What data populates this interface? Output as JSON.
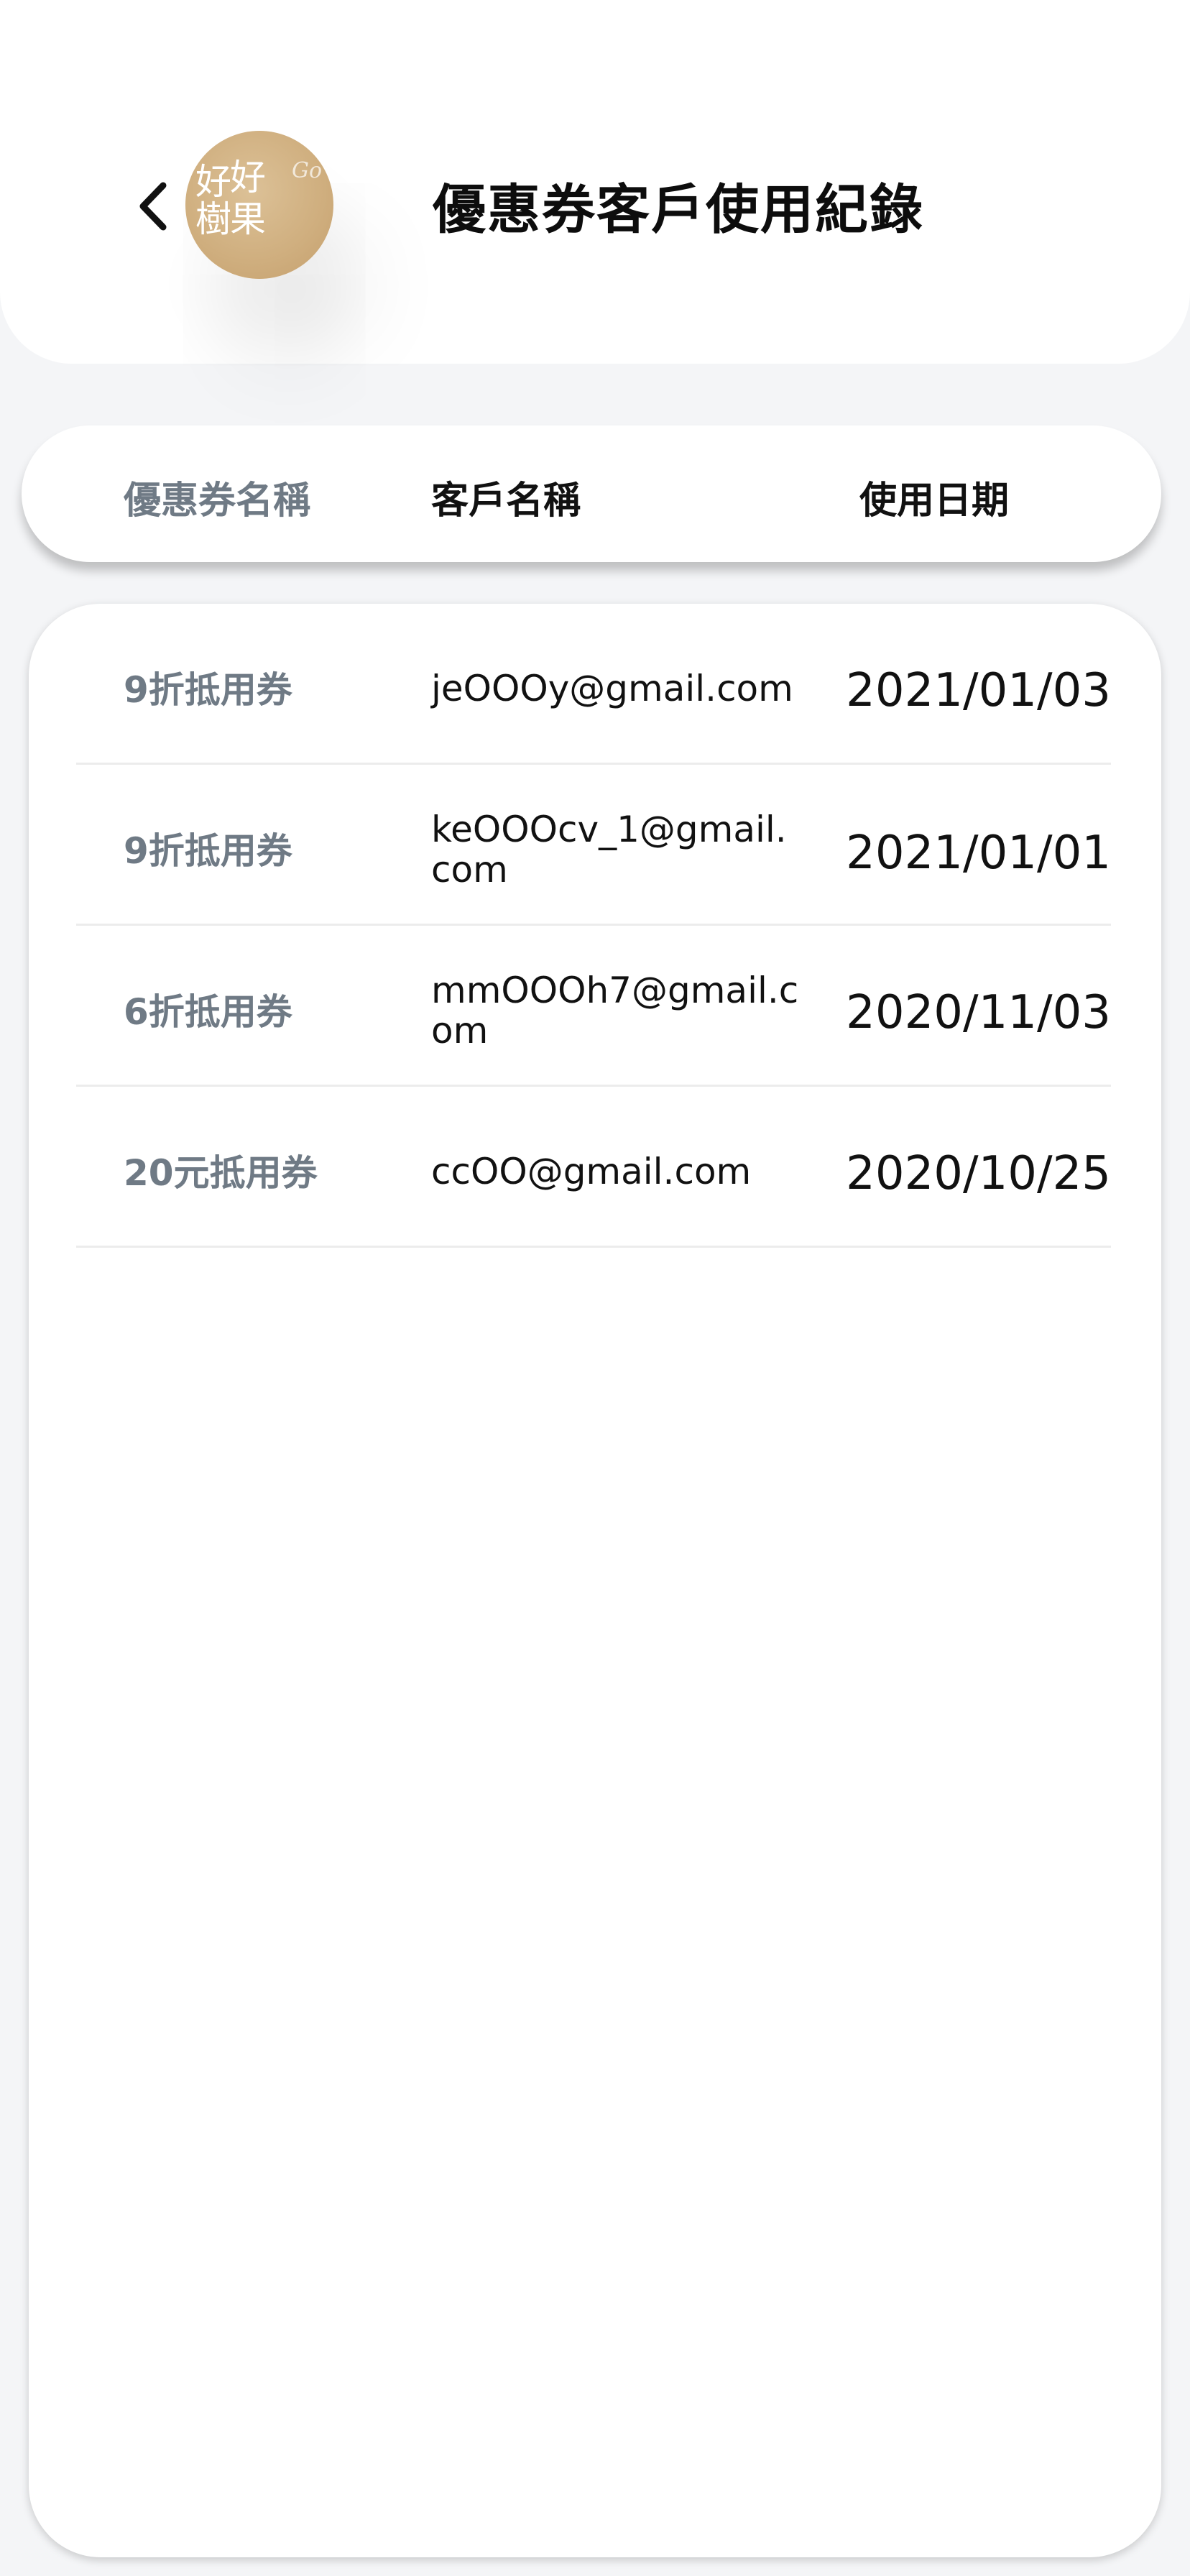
{
  "header": {
    "title": "優惠券客戶使用紀錄",
    "logo_chars": [
      "好",
      "好",
      "樹",
      "果"
    ],
    "logo_script": "Go"
  },
  "columns": {
    "coupon": "優惠券名稱",
    "customer": "客戶名稱",
    "date": "使用日期"
  },
  "rows": [
    {
      "coupon": "9折抵用券",
      "email": "jeOOOy@gmail.com",
      "date": "2021/01/03"
    },
    {
      "coupon": "9折抵用券",
      "email": "keOOOcv_1@gmail.com",
      "date": "2021/01/01"
    },
    {
      "coupon": "6折抵用券",
      "email": "mmOOOh7@gmail.com",
      "date": "2020/11/03"
    },
    {
      "coupon": "20元抵用券",
      "email": "ccOO@gmail.com",
      "date": "2020/10/25"
    }
  ],
  "icons": {
    "back": "chevron-left-icon"
  },
  "colors": {
    "background": "#f4f5f7",
    "muted_text": "#6f7a85",
    "logo": "#cfae7e"
  }
}
